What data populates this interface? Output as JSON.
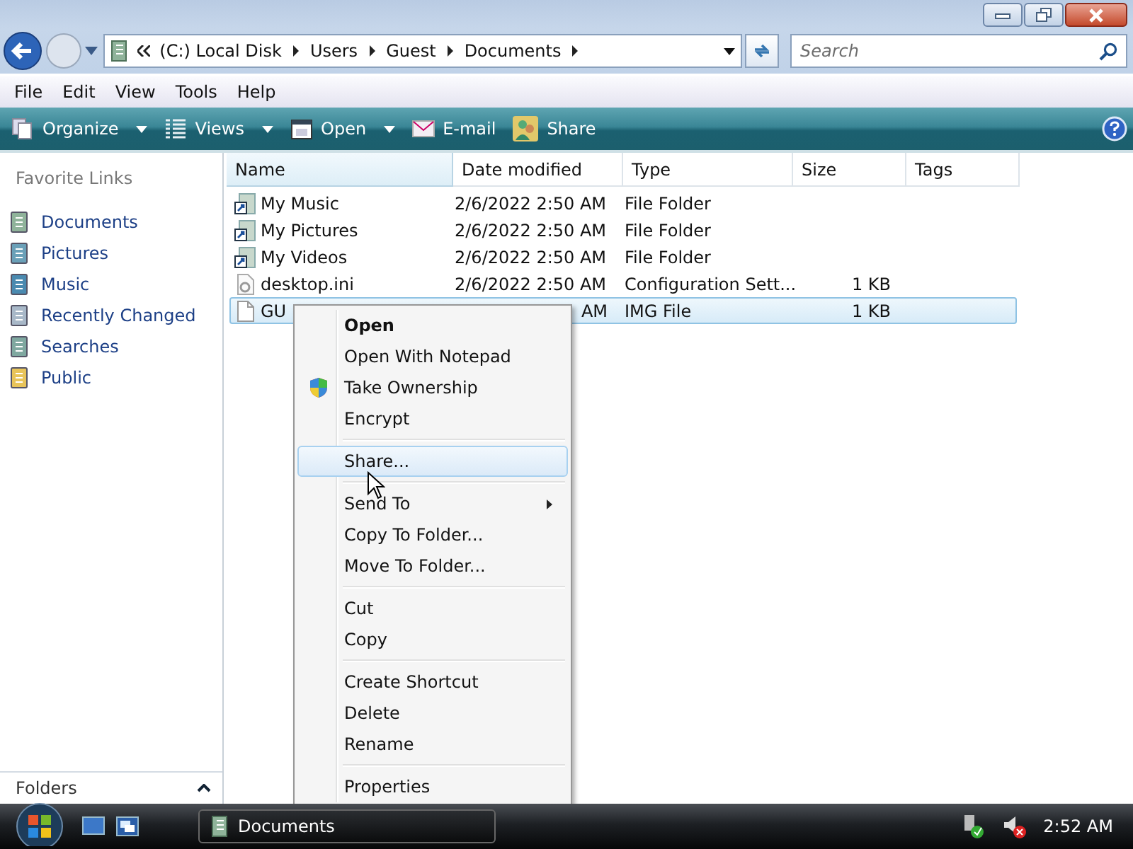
{
  "address": {
    "path": [
      "(C:) Local Disk",
      "Users",
      "Guest",
      "Documents"
    ]
  },
  "search": {
    "placeholder": "Search"
  },
  "menu_bar": [
    "File",
    "Edit",
    "View",
    "Tools",
    "Help"
  ],
  "toolbar": [
    {
      "label": "Organize",
      "dropdown": true
    },
    {
      "label": "Views",
      "dropdown": true
    },
    {
      "label": "Open",
      "dropdown": true
    },
    {
      "label": "E-mail",
      "dropdown": false
    },
    {
      "label": "Share",
      "dropdown": false
    }
  ],
  "sidebar": {
    "title": "Favorite Links",
    "items": [
      {
        "label": "Documents"
      },
      {
        "label": "Pictures"
      },
      {
        "label": "Music"
      },
      {
        "label": "Recently Changed"
      },
      {
        "label": "Searches"
      },
      {
        "label": "Public"
      }
    ],
    "footer": "Folders"
  },
  "file_list": {
    "columns": [
      "Name",
      "Date modified",
      "Type",
      "Size",
      "Tags"
    ],
    "rows": [
      {
        "kind": "shortcut",
        "name": "My Music",
        "date": "2/6/2022 2:50 AM",
        "type": "File Folder",
        "size": "",
        "selected": false
      },
      {
        "kind": "shortcut",
        "name": "My Pictures",
        "date": "2/6/2022 2:50 AM",
        "type": "File Folder",
        "size": "",
        "selected": false
      },
      {
        "kind": "shortcut",
        "name": "My Videos",
        "date": "2/6/2022 2:50 AM",
        "type": "File Folder",
        "size": "",
        "selected": false
      },
      {
        "kind": "settings",
        "name": "desktop.ini",
        "date": "2/6/2022 2:50 AM",
        "type": "Configuration Sett...",
        "size": "1 KB",
        "selected": false
      },
      {
        "kind": "file",
        "name": "GU",
        "date": "AM",
        "type": "IMG File",
        "size": "1 KB",
        "selected": true
      }
    ]
  },
  "context_menu": [
    {
      "kind": "item",
      "label": "Open",
      "default": true,
      "shield": false,
      "submenu": false,
      "selected": false
    },
    {
      "kind": "item",
      "label": "Open With Notepad",
      "default": false,
      "shield": false,
      "submenu": false,
      "selected": false
    },
    {
      "kind": "item",
      "label": "Take Ownership",
      "default": false,
      "shield": true,
      "submenu": false,
      "selected": false
    },
    {
      "kind": "item",
      "label": "Encrypt",
      "default": false,
      "shield": false,
      "submenu": false,
      "selected": false
    },
    {
      "kind": "separator"
    },
    {
      "kind": "item",
      "label": "Share...",
      "default": false,
      "shield": false,
      "submenu": false,
      "selected": true
    },
    {
      "kind": "separator"
    },
    {
      "kind": "item",
      "label": "Send To",
      "default": false,
      "shield": false,
      "submenu": true,
      "selected": false
    },
    {
      "kind": "item",
      "label": "Copy To Folder...",
      "default": false,
      "shield": false,
      "submenu": false,
      "selected": false
    },
    {
      "kind": "item",
      "label": "Move To Folder...",
      "default": false,
      "shield": false,
      "submenu": false,
      "selected": false
    },
    {
      "kind": "separator"
    },
    {
      "kind": "item",
      "label": "Cut",
      "default": false,
      "shield": false,
      "submenu": false,
      "selected": false
    },
    {
      "kind": "item",
      "label": "Copy",
      "default": false,
      "shield": false,
      "submenu": false,
      "selected": false
    },
    {
      "kind": "separator"
    },
    {
      "kind": "item",
      "label": "Create Shortcut",
      "default": false,
      "shield": false,
      "submenu": false,
      "selected": false
    },
    {
      "kind": "item",
      "label": "Delete",
      "default": false,
      "shield": false,
      "submenu": false,
      "selected": false
    },
    {
      "kind": "item",
      "label": "Rename",
      "default": false,
      "shield": false,
      "submenu": false,
      "selected": false
    },
    {
      "kind": "separator"
    },
    {
      "kind": "item",
      "label": "Properties",
      "default": false,
      "shield": false,
      "submenu": false,
      "selected": false
    }
  ],
  "taskbar": {
    "window_button": "Documents",
    "clock": "2:52 AM"
  }
}
